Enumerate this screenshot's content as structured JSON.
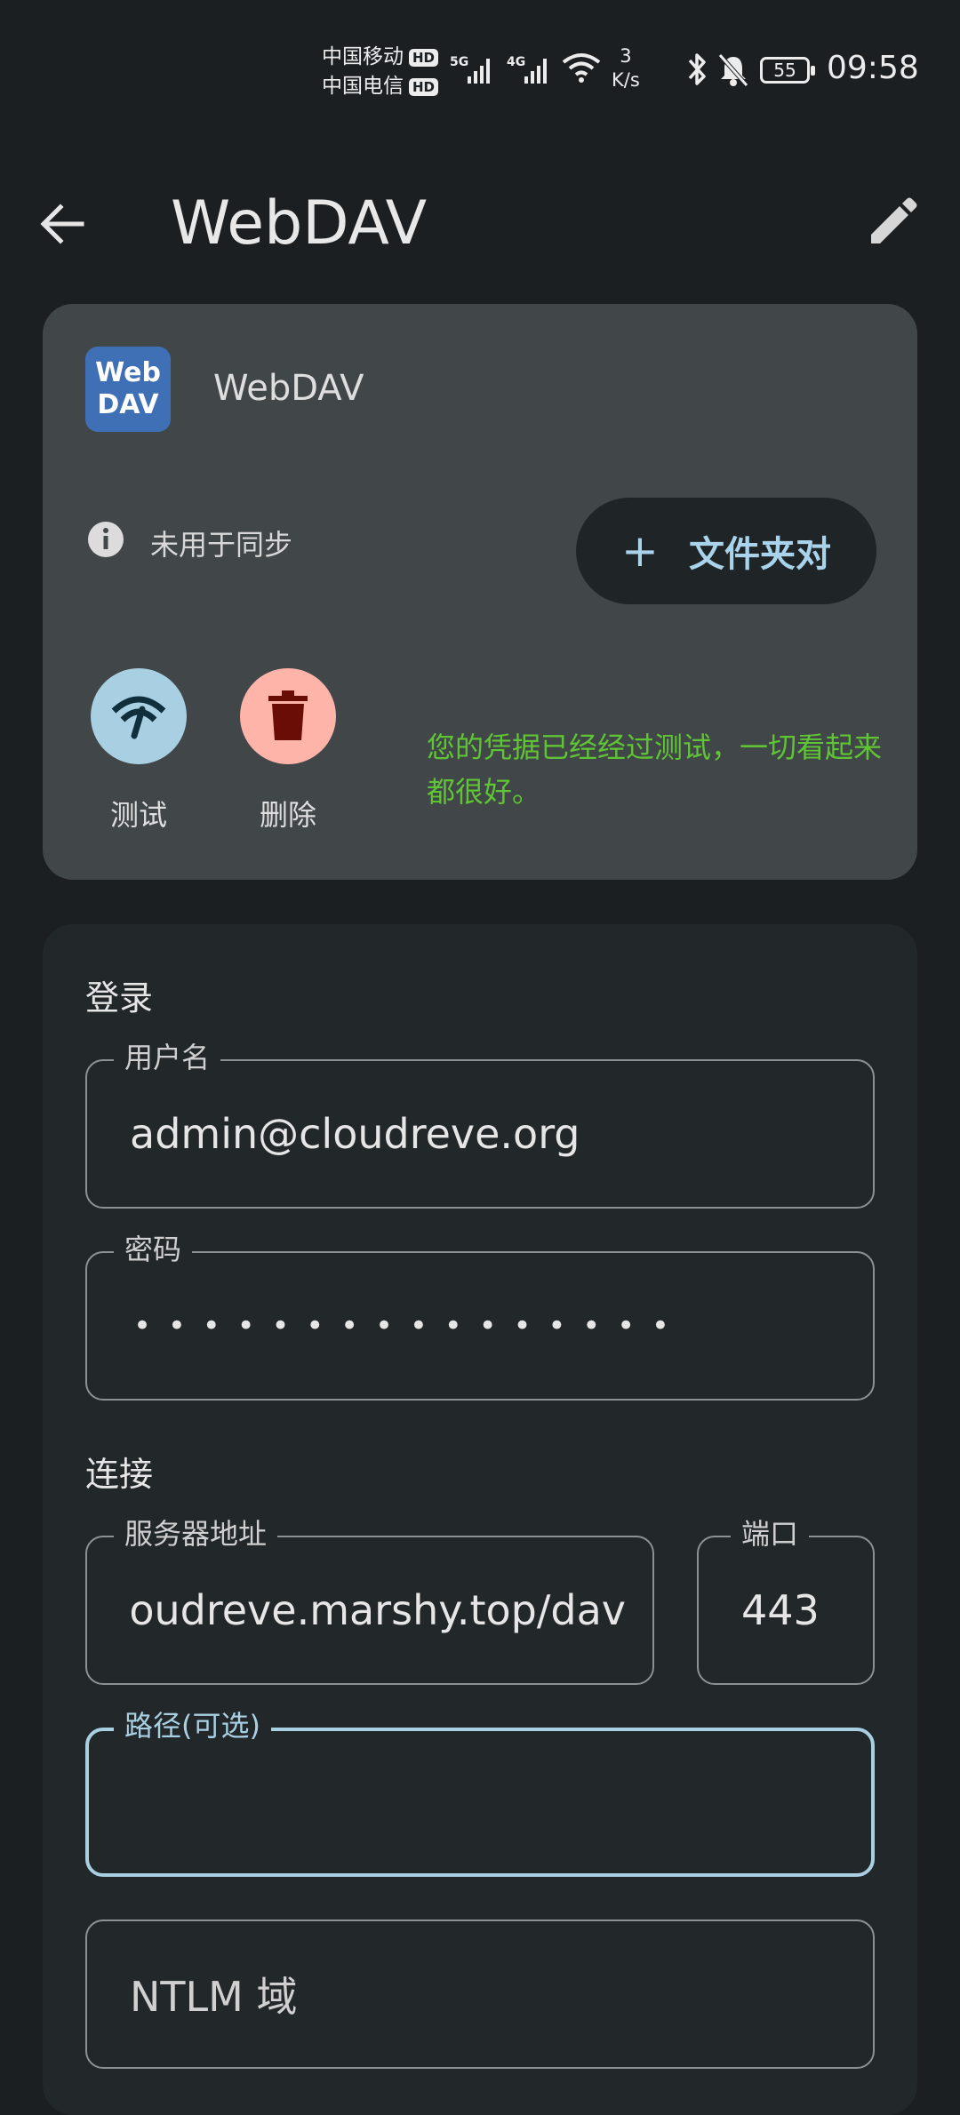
{
  "status_bar": {
    "carrier1": "中国移动",
    "carrier2": "中国电信",
    "hd": "HD",
    "net1": "5G",
    "net2": "4G",
    "speed_value": "3",
    "speed_unit": "K/s",
    "battery": "55",
    "time": "09:58"
  },
  "app_bar": {
    "title": "WebDAV"
  },
  "account_card": {
    "logo_line1": "Web",
    "logo_line2": "DAV",
    "name": "WebDAV",
    "sync_status": "未用于同步",
    "add_pair_label": "文件夹对",
    "add_pair_icon": "+",
    "test_label": "测试",
    "delete_label": "删除",
    "message": "您的凭据已经经过测试，一切看起来都很好。",
    "message_color": "#5fc534"
  },
  "login": {
    "section_title": "登录",
    "username_label": "用户名",
    "username_value": "admin@cloudreve.org",
    "password_label": "密码",
    "password_value": "• • • • • • • • • • • • • • • •"
  },
  "connection": {
    "section_title": "连接",
    "server_label": "服务器地址",
    "server_value": "oudreve.marshy.top/dav",
    "port_label": "端口",
    "port_value": "443",
    "path_label": "路径(可选)",
    "path_value": "",
    "ntlm_placeholder": "NTLM 域"
  },
  "colors": {
    "background": "#1b1f22",
    "card": "#414649",
    "accent": "#a9cfe3",
    "delete": "#ffb4a9"
  }
}
